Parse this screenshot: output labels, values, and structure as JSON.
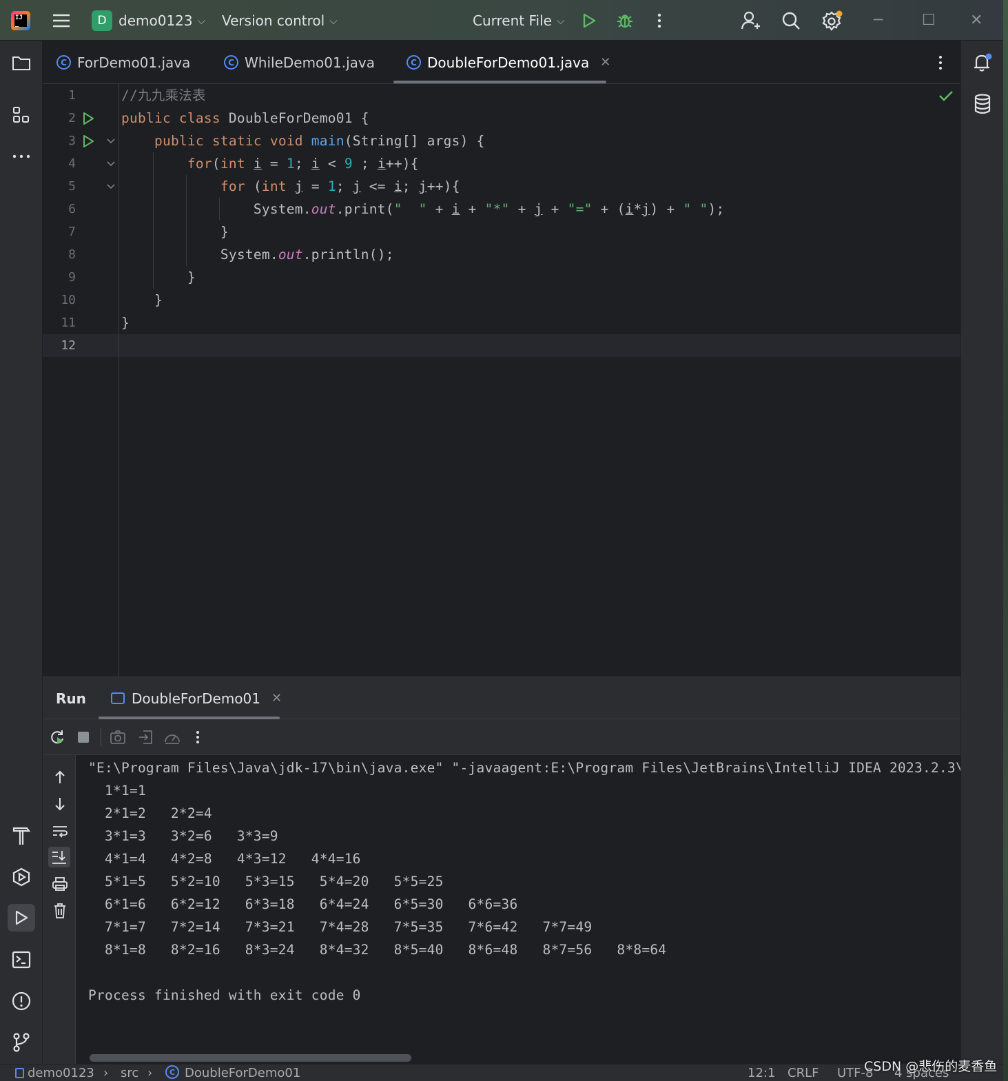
{
  "titlebar": {
    "project_initial": "D",
    "project_name": "demo0123",
    "vcs": "Version control",
    "run_config": "Current File"
  },
  "tabs": [
    {
      "label": "ForDemo01.java",
      "active": false
    },
    {
      "label": "WhileDemo01.java",
      "active": false
    },
    {
      "label": "DoubleForDemo01.java",
      "active": true
    }
  ],
  "editor": {
    "line_numbers": [
      "1",
      "2",
      "3",
      "4",
      "5",
      "6",
      "7",
      "8",
      "9",
      "10",
      "11",
      "12"
    ],
    "current_line": "12"
  },
  "run_panel": {
    "title": "Run",
    "tab_label": "DoubleForDemo01",
    "output": [
      "\"E:\\Program Files\\Java\\jdk-17\\bin\\java.exe\" \"-javaagent:E:\\Program Files\\JetBrains\\IntelliJ IDEA 2023.2.3\\",
      "  1*1=1",
      "  2*1=2   2*2=4",
      "  3*1=3   3*2=6   3*3=9",
      "  4*1=4   4*2=8   4*3=12   4*4=16",
      "  5*1=5   5*2=10   5*3=15   5*4=20   5*5=25",
      "  6*1=6   6*2=12   6*3=18   6*4=24   6*5=30   6*6=36",
      "  7*1=7   7*2=14   7*3=21   7*4=28   7*5=35   7*6=42   7*7=49",
      "  8*1=8   8*2=16   8*3=24   8*4=32   8*5=40   8*6=48   8*7=56   8*8=64",
      "",
      "Process finished with exit code 0"
    ]
  },
  "statusbar": {
    "breadcrumb_project": "demo0123",
    "breadcrumb_src": "src",
    "breadcrumb_class": "DoubleForDemo01",
    "position": "12:1",
    "line_ending": "CRLF",
    "encoding": "UTF-8",
    "indent": "4 spaces"
  },
  "watermark": "CSDN @悲伤的麦香鱼",
  "colors": {
    "keyword": "#cf8e6d",
    "function": "#56a8f5",
    "number": "#2aacb8",
    "string": "#6aab73",
    "field": "#c77dbb",
    "comment": "#7a7e85",
    "accent": "#548af7",
    "run_green": "#5fb865"
  }
}
